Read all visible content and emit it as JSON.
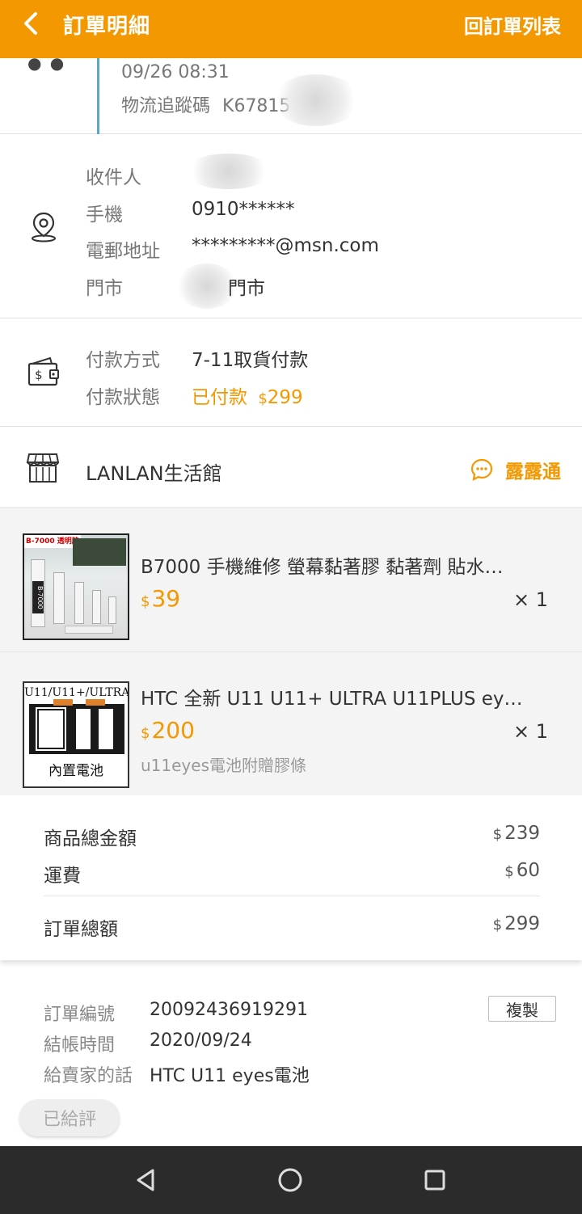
{
  "header": {
    "title": "訂單明細",
    "back_list_label": "回訂單列表"
  },
  "tracking": {
    "time": "09/26 08:31",
    "code_label": "物流追蹤碼",
    "code_value": "K67815"
  },
  "recipient": {
    "name_label": "收件人",
    "name_value": "",
    "phone_label": "手機",
    "phone_value": "0910******",
    "email_label": "電郵地址",
    "email_value": "*********@msn.com",
    "store_label": "門市",
    "store_value": "門市"
  },
  "payment": {
    "method_label": "付款方式",
    "method_value": "7-11取貨付款",
    "status_label": "付款狀態",
    "status_value": "已付款",
    "status_currency": "$",
    "status_amount": "299"
  },
  "shop": {
    "name": "LANLAN生活館",
    "chat_label": "露露通"
  },
  "products": [
    {
      "name": "B7000 手機維修 螢幕黏著膠 黏著劑 貼水…",
      "currency": "$",
      "price": "39",
      "qty": "× 1",
      "thumb_text": "B-7000 透明胶",
      "tube_label": "B-7000"
    },
    {
      "name": "HTC 全新 U11 U11+ ULTRA U11PLUS ey…",
      "currency": "$",
      "price": "200",
      "qty": "× 1",
      "spec": "u11eyes電池附贈膠條",
      "thumb_top": "U11/U11+/ULTRA",
      "thumb_bottom": "內置電池"
    }
  ],
  "summary": {
    "subtotal_label": "商品總金額",
    "subtotal_currency": "$",
    "subtotal_value": "239",
    "shipping_label": "運費",
    "shipping_currency": "$",
    "shipping_value": "60",
    "total_label": "訂單總額",
    "total_currency": "$",
    "total_value": "299"
  },
  "order_info": {
    "order_no_label": "訂單編號",
    "order_no_value": "20092436919291",
    "copy_label": "複製",
    "checkout_label": "結帳時間",
    "checkout_value": "2020/09/24",
    "note_label": "給賣家的話",
    "note_value": "HTC U11 eyes電池",
    "rated_label": "已給評"
  },
  "colors": {
    "brand": "#f39800",
    "timeline": "#5aa7c6",
    "navbar": "#2b2b2b"
  },
  "icons": [
    "back-arrow-icon",
    "location-pin-icon",
    "wallet-icon",
    "store-icon",
    "chat-bubble-icon",
    "nav-back-icon",
    "nav-home-icon",
    "nav-recents-icon"
  ]
}
